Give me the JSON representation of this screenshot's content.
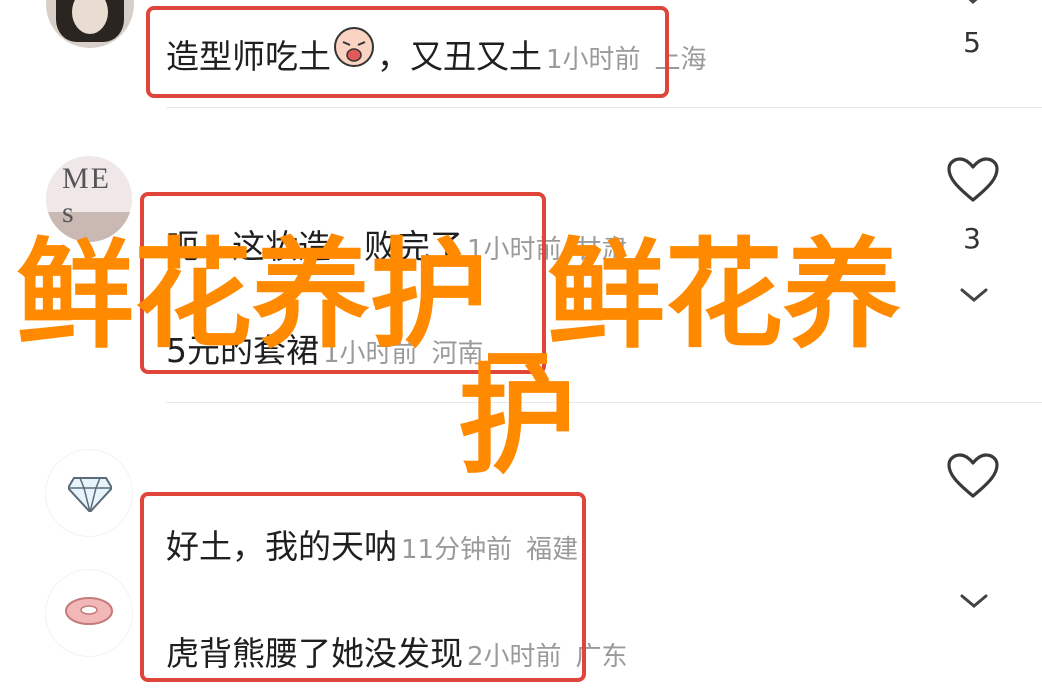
{
  "comments": [
    {
      "text_before": "造型师吃土",
      "emoji": "crying-face-emoji",
      "text_after": "，又丑又土",
      "time": "1小时前",
      "location": "上海",
      "likes": "5"
    },
    {
      "text": "呃…这妆造…败完了",
      "time": "1小时前",
      "location": "甘肃",
      "likes": "3"
    },
    {
      "text": "5元的套裙",
      "time": "1小时前",
      "location": "河南"
    },
    {
      "text": "好土，我的天呐",
      "time": "11分钟前",
      "location": "福建"
    },
    {
      "text": "虎背熊腰了她没发现",
      "time": "2小时前",
      "location": "广东"
    }
  ],
  "avatars": {
    "avatar2_text": "ME s"
  },
  "watermark": {
    "line1": "鲜花养护_鲜花养",
    "line2": "护"
  },
  "colors": {
    "highlight": "#e0453a",
    "watermark": "#ff8a00",
    "meta": "#9a9a9a"
  }
}
